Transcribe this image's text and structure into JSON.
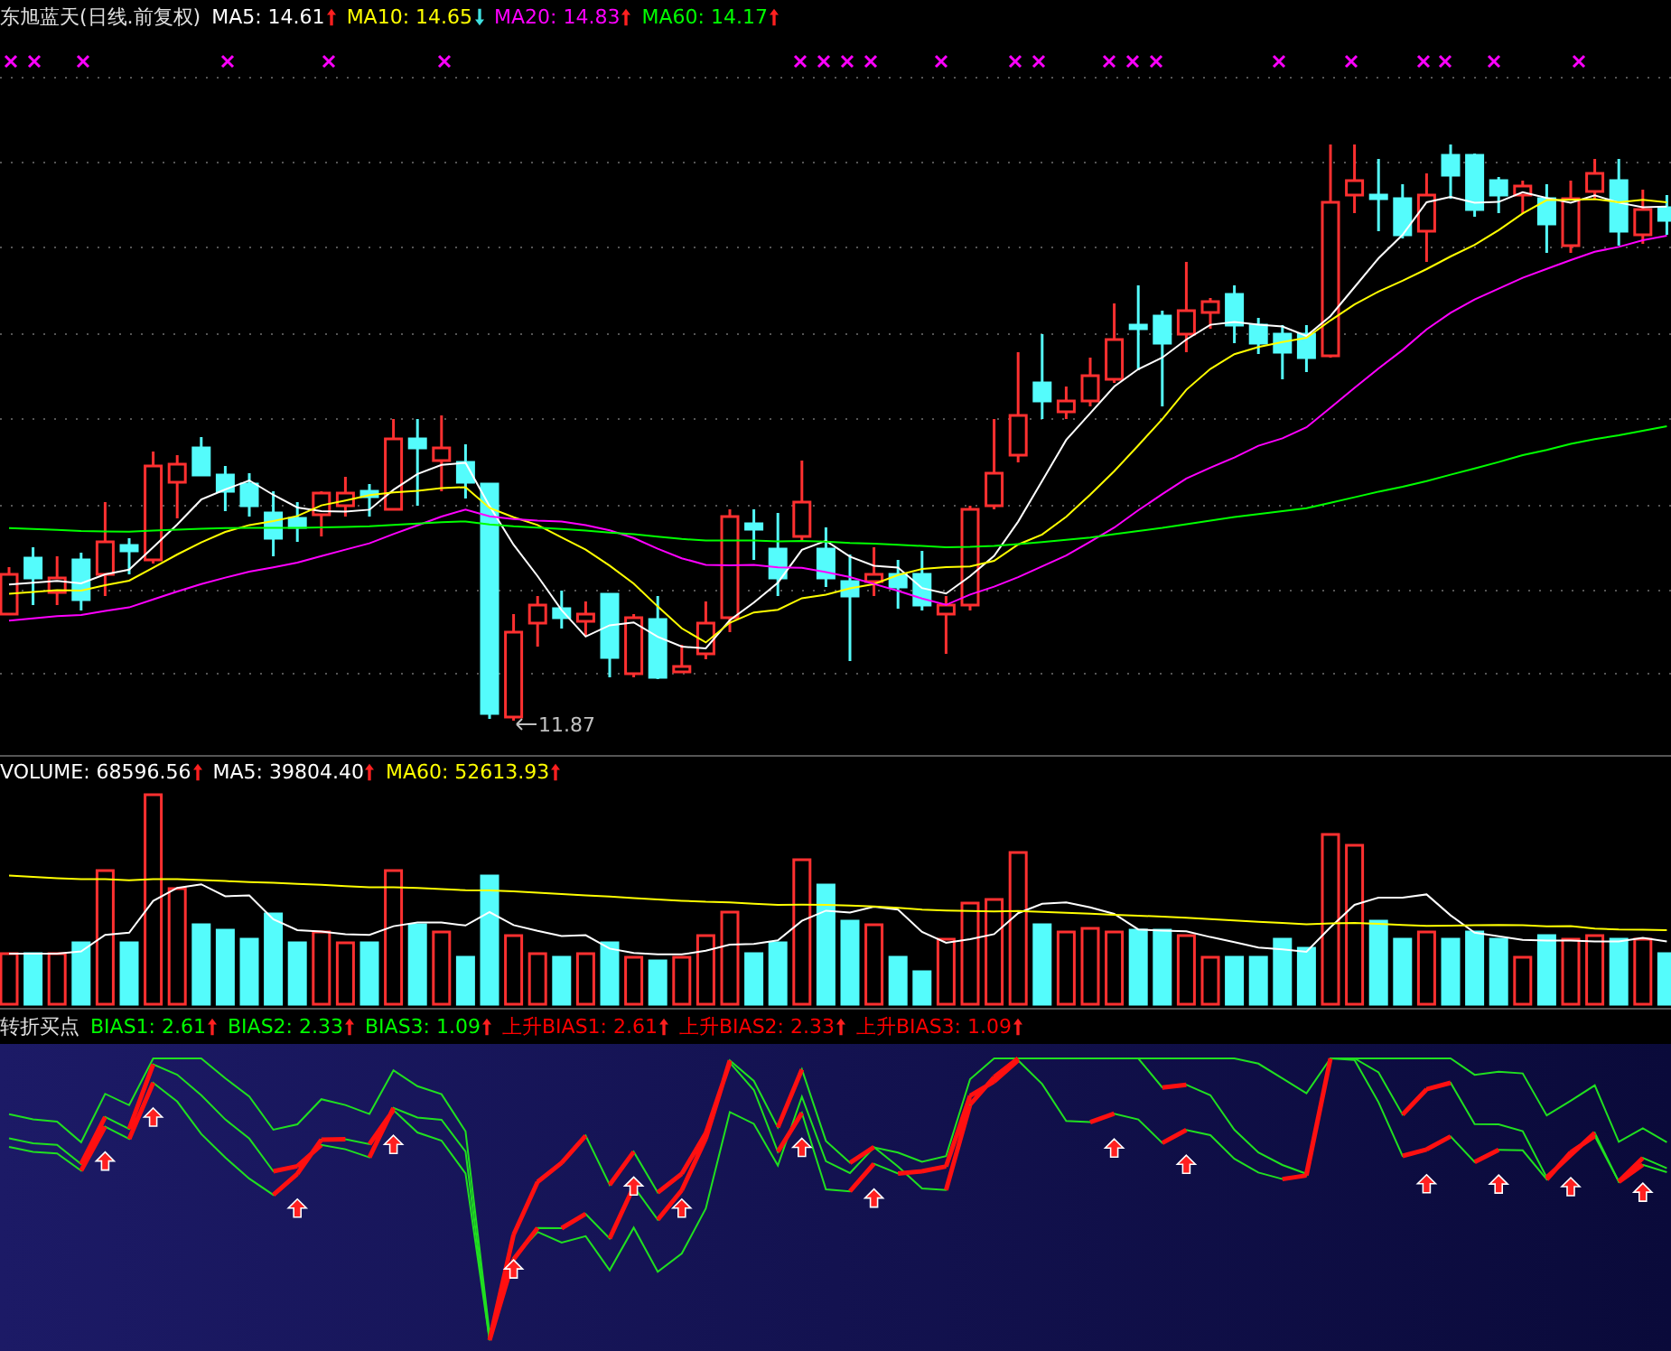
{
  "price_panel": {
    "title": "东旭蓝天(日线.前复权)",
    "legend": [
      {
        "label": "MA5: 14.61",
        "color": "#ffffff",
        "rising": true
      },
      {
        "label": "MA10: 14.65",
        "color": "#ffff00",
        "rising": false
      },
      {
        "label": "MA20: 14.83",
        "color": "#ff00ff",
        "rising": true
      },
      {
        "label": "MA60: 14.17",
        "color": "#00ff00",
        "rising": true
      }
    ],
    "low_label": "11.87"
  },
  "volume_panel": {
    "legend": [
      {
        "label": "VOLUME: 68596.56",
        "color": "#ffffff",
        "rising": true
      },
      {
        "label": "MA5: 39804.40",
        "color": "#ffffff",
        "rising": true
      },
      {
        "label": "MA60: 52613.93",
        "color": "#ffff00",
        "rising": true
      }
    ]
  },
  "indicator_panel": {
    "title": "转折买点",
    "legend": [
      {
        "label": "BIAS1: 2.61",
        "color": "#00ff00",
        "rising": true
      },
      {
        "label": "BIAS2: 2.33",
        "color": "#00ff00",
        "rising": true
      },
      {
        "label": "BIAS3: 1.09",
        "color": "#00ff00",
        "rising": true
      },
      {
        "label": "上升BIAS1: 2.61",
        "color": "#ff0000",
        "rising": true
      },
      {
        "label": "上升BIAS2: 2.33",
        "color": "#ff0000",
        "rising": true
      },
      {
        "label": "上升BIAS3: 1.09",
        "color": "#ff0000",
        "rising": true
      }
    ]
  }
}
